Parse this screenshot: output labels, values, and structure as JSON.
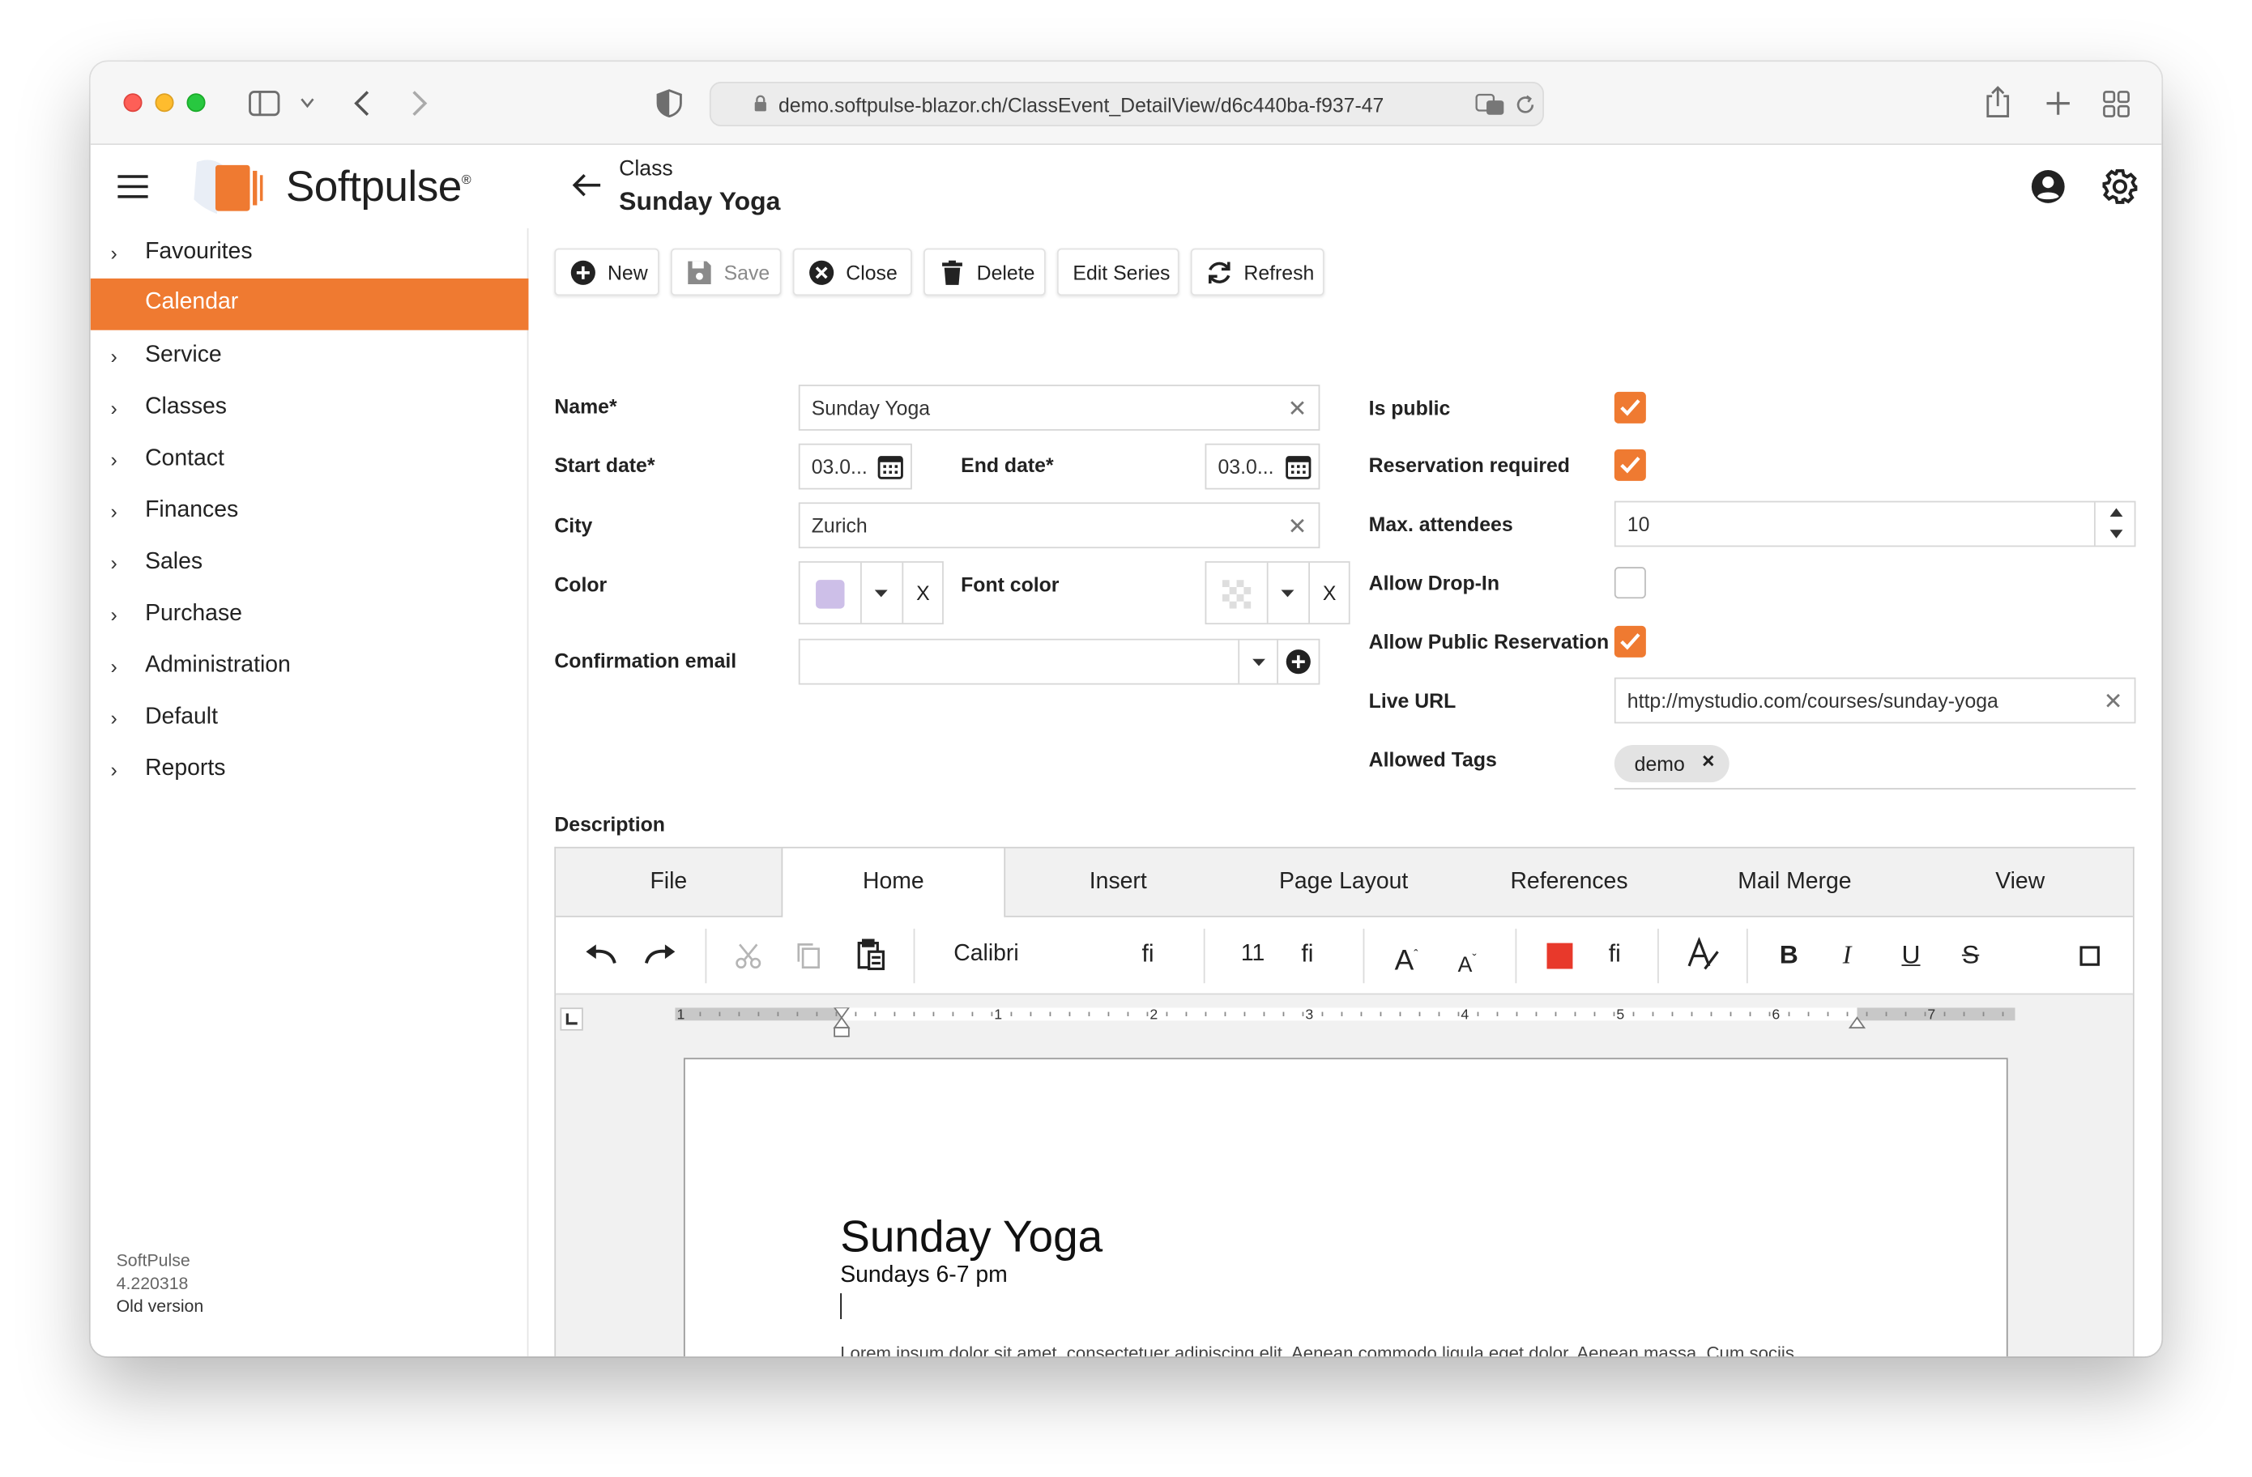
{
  "browser": {
    "url": "demo.softpulse-blazor.ch/ClassEvent_DetailView/d6c440ba-f937-47"
  },
  "app": {
    "logo_text": "Softpulse",
    "logo_reg": "®",
    "breadcrumb_parent": "Class",
    "breadcrumb_title": "Sunday Yoga"
  },
  "sidebar": {
    "items": [
      {
        "label": "Favourites",
        "chevron": "›"
      },
      {
        "label": "Calendar",
        "active": true
      },
      {
        "label": "Service",
        "chevron": "›"
      },
      {
        "label": "Classes",
        "chevron": "›"
      },
      {
        "label": "Contact",
        "chevron": "›"
      },
      {
        "label": "Finances",
        "chevron": "›"
      },
      {
        "label": "Sales",
        "chevron": "›"
      },
      {
        "label": "Purchase",
        "chevron": "›"
      },
      {
        "label": "Administration",
        "chevron": "›"
      },
      {
        "label": "Default",
        "chevron": "›"
      },
      {
        "label": "Reports",
        "chevron": "›"
      }
    ],
    "footer_name": "SoftPulse",
    "footer_version": "4.220318",
    "footer_old": "Old version"
  },
  "toolbar": {
    "new": "New",
    "save": "Save",
    "close": "Close",
    "delete": "Delete",
    "edit_series": "Edit Series",
    "refresh": "Refresh"
  },
  "form": {
    "name_label": "Name*",
    "name_value": "Sunday Yoga",
    "start_label": "Start date*",
    "start_value": "03.0...",
    "end_label": "End date*",
    "end_value": "03.0...",
    "city_label": "City",
    "city_value": "Zurich",
    "color_label": "Color",
    "color_value": "#cdbfe8",
    "font_color_label": "Font color",
    "clear_x": "X",
    "confirmation_label": "Confirmation email",
    "confirmation_value": "",
    "is_public_label": "Is public",
    "is_public": true,
    "reservation_label": "Reservation required",
    "reservation": true,
    "max_label": "Max. attendees",
    "max_value": "10",
    "dropin_label": "Allow Drop-In",
    "dropin": false,
    "public_res_label": "Allow Public Reservation",
    "public_res": true,
    "live_url_label": "Live URL",
    "live_url_value": "http://mystudio.com/courses/sunday-yoga",
    "tags_label": "Allowed Tags",
    "tag_demo": "demo",
    "description_label": "Description"
  },
  "editor": {
    "tabs": [
      "File",
      "Home",
      "Insert",
      "Page Layout",
      "References",
      "Mail Merge",
      "View"
    ],
    "active_tab": "Home",
    "font_name": "Calibri",
    "font_size": "11",
    "dropdown_glyph": "ﬁ",
    "ruler_numbers": [
      "1",
      "1",
      "2",
      "3",
      "4",
      "5",
      "6",
      "7"
    ],
    "doc_title": "Sunday Yoga",
    "doc_subtitle": "Sundays 6-7 pm",
    "doc_body": "Lorem ipsum dolor sit amet, consectetuer adipiscing elit. Aenean commodo ligula eget dolor. Aenean massa. Cum sociis natoque penatibus et magnis dis parturient montes, nascetur ridiculus mus. Donec quam felis, ultricies nec, pellentesque eu, pretium quis, sem. Nulla consequat massa quis enim. Donec pede justo, fringilla vel, aliquet nec, vulputate eget, arcu. In enim justo, rhoncus ut, imperdiet a, venenatis vitae, justo. Nullam"
  },
  "colors": {
    "accent": "#ef7a31",
    "font_color_swatch": "transparent",
    "text_color_swatch": "#e8392b"
  }
}
